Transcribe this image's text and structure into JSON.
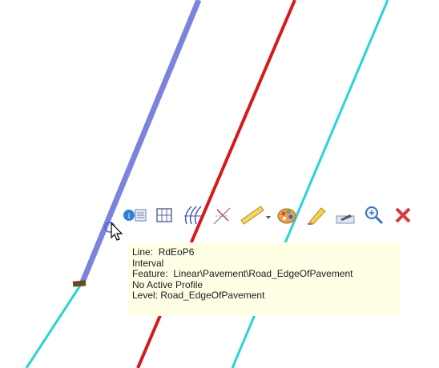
{
  "tooltip": {
    "line": "Line:  RdEoP6",
    "interval": "Interval",
    "feature": "Feature:  Linear\\Pavement\\Road_EdgeOfPavement",
    "profile": "No Active Profile",
    "level": "Level: Road_EdgeOfPavement"
  },
  "colors": {
    "selected_line": "#7b83dd",
    "red_line": "#d41b1b",
    "cyan_line": "#2ad3d6",
    "tooltip_bg": "#ffffe6",
    "endpoint_marker": "#6b4a1f"
  },
  "toolbar_icons": [
    "info-icon",
    "table-grid-icon",
    "profile-curves-icon",
    "snap-lines-icon",
    "ruler-dropdown-icon",
    "color-palette-icon",
    "highlighter-icon",
    "element-template-icon",
    "zoom-icon",
    "close-icon"
  ]
}
